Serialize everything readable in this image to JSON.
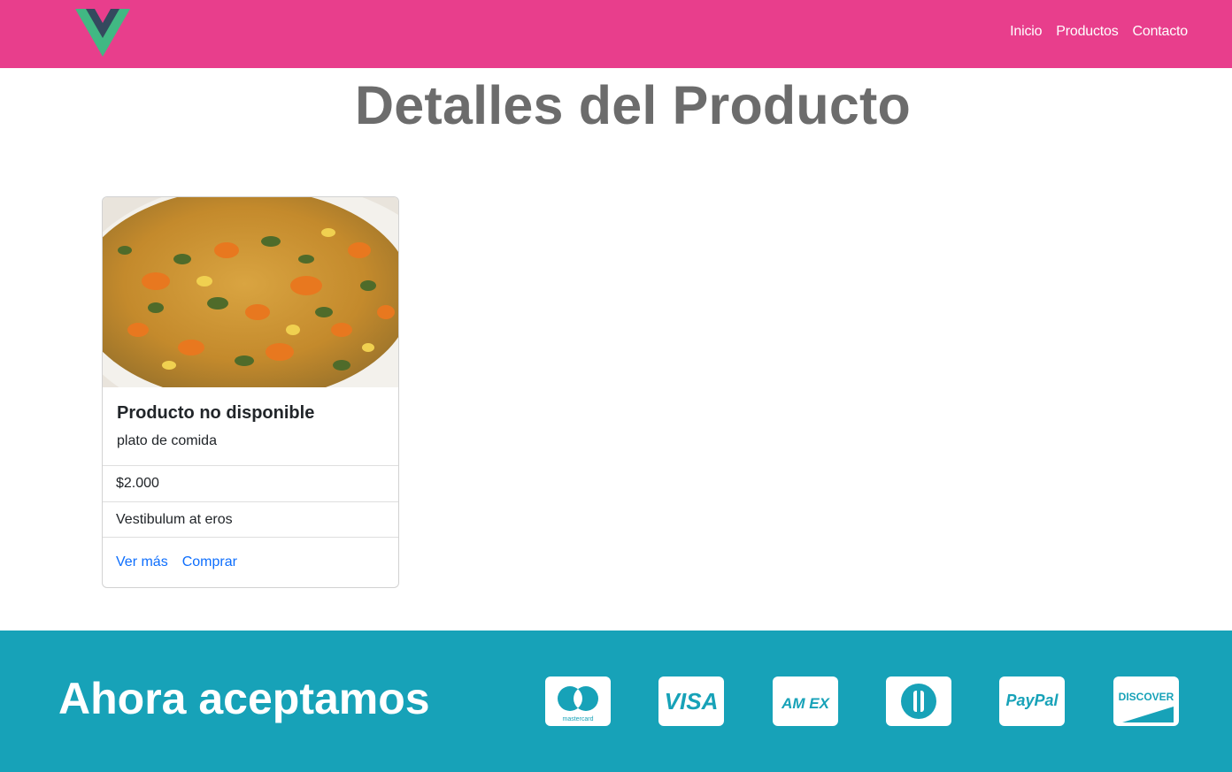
{
  "nav": {
    "links": [
      "Inicio",
      "Productos",
      "Contacto"
    ]
  },
  "page": {
    "title": "Detalles del Producto"
  },
  "product": {
    "title": "Producto no disponible",
    "description": "plato de comida",
    "price": "$2.000",
    "detail": "Vestibulum at eros",
    "links": [
      "Ver más",
      "Comprar"
    ]
  },
  "footer": {
    "title": "Ahora aceptamos",
    "payment_methods": [
      {
        "name": "mastercard-icon",
        "label": "mastercard"
      },
      {
        "name": "visa-icon",
        "label": "VISA"
      },
      {
        "name": "amex-icon",
        "label": "AM EX"
      },
      {
        "name": "diners-icon",
        "label": ""
      },
      {
        "name": "paypal-icon",
        "label": "PayPal"
      },
      {
        "name": "discover-icon",
        "label": "DISCOVER"
      }
    ]
  },
  "colors": {
    "navbar": "#e83e8c",
    "footer": "#17a2b8",
    "link": "#0d6efd",
    "title": "#6c6c6c",
    "vue_green": "#41b883",
    "vue_dark": "#34495e"
  }
}
